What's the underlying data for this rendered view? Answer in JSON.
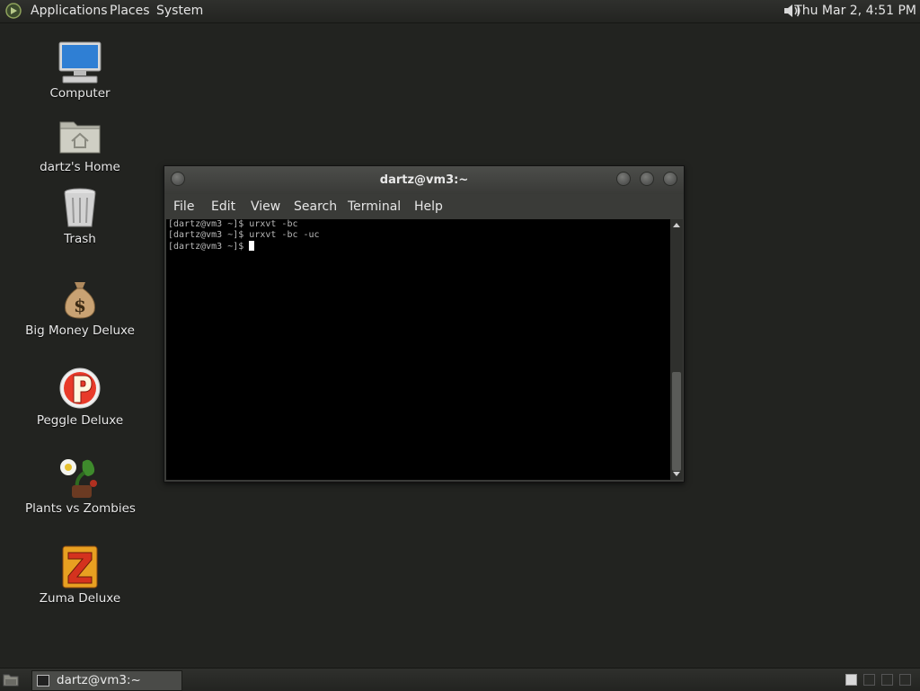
{
  "top_panel": {
    "menus": [
      "Applications",
      "Places",
      "System"
    ],
    "clock": "Thu Mar  2,  4:51 PM"
  },
  "desktop": {
    "icons": [
      {
        "label": "Computer",
        "icon": "computer-icon"
      },
      {
        "label": "dartz's Home",
        "icon": "home-folder-icon"
      },
      {
        "label": "Trash",
        "icon": "trash-icon"
      },
      {
        "label": "Big Money Deluxe",
        "icon": "money-bag-icon"
      },
      {
        "label": "Peggle Deluxe",
        "icon": "peggle-icon"
      },
      {
        "label": "Plants vs Zombies",
        "icon": "plants-icon"
      },
      {
        "label": "Zuma Deluxe",
        "icon": "zuma-icon"
      }
    ]
  },
  "terminal": {
    "title": "dartz@vm3:~",
    "menu": [
      "File",
      "Edit",
      "View",
      "Search",
      "Terminal",
      "Help"
    ],
    "lines": [
      "[dartz@vm3 ~]$ urxvt -bc",
      "[dartz@vm3 ~]$ urxvt -bc -uc",
      "[dartz@vm3 ~]$ "
    ]
  },
  "taskbar": {
    "task_label": "dartz@vm3:~"
  },
  "colors": {
    "desktop_bg": "#222320",
    "panel_bg": "#2a2b28",
    "terminal_bg": "#000000"
  }
}
